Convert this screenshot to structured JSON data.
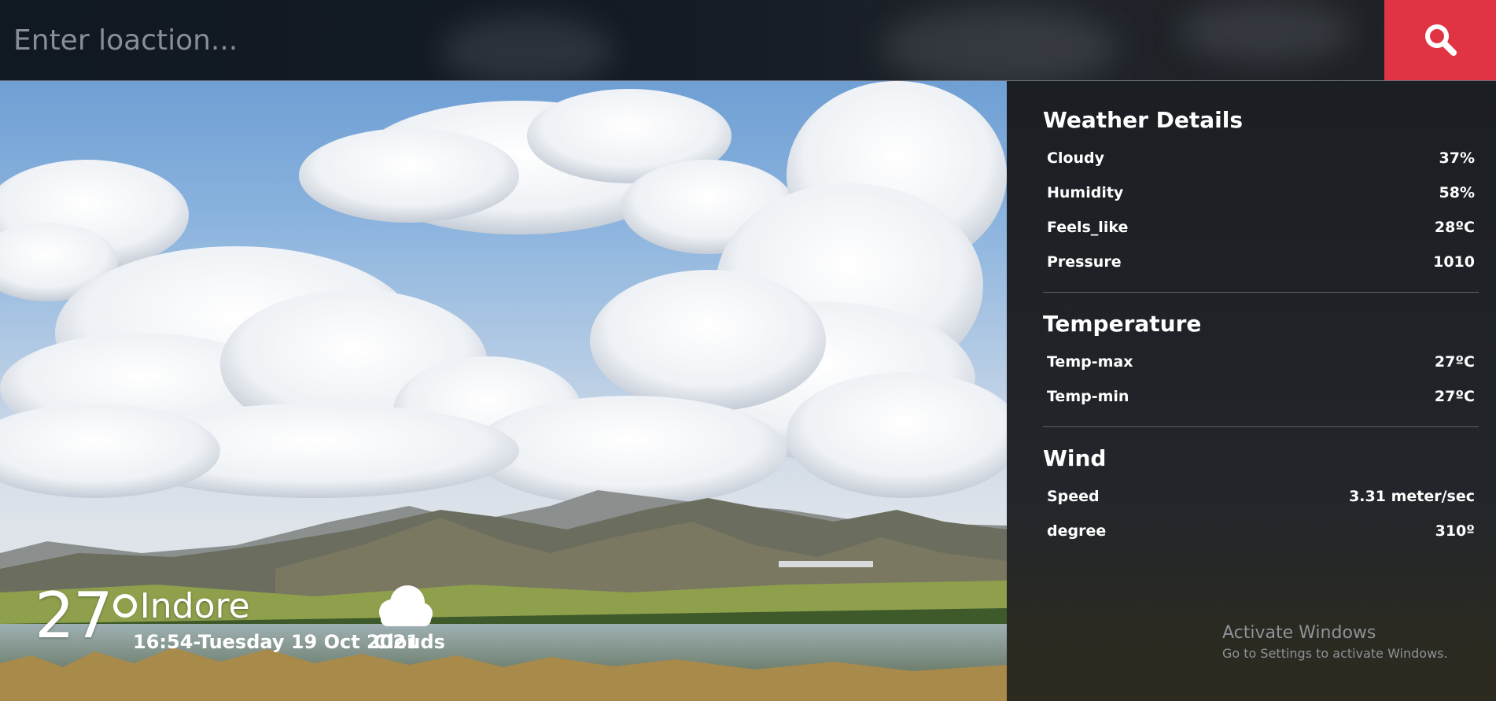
{
  "search": {
    "placeholder": "Enter loaction...",
    "button_icon": "search-icon",
    "button_color": "#e03444"
  },
  "current": {
    "temperature": "27",
    "degree_symbol": "o",
    "city": "Indore",
    "datetime": "16:54-Tuesday 19 Oct 2021",
    "condition": "Clouds",
    "condition_icon": "cloud-icon"
  },
  "details": {
    "weather": {
      "title": "Weather Details",
      "rows": [
        {
          "label": "Cloudy",
          "value": "37%"
        },
        {
          "label": "Humidity",
          "value": "58%"
        },
        {
          "label": "Feels_like",
          "value": "28ºC"
        },
        {
          "label": "Pressure",
          "value": "1010"
        }
      ]
    },
    "temperature": {
      "title": "Temperature",
      "rows": [
        {
          "label": "Temp-max",
          "value": "27ºC"
        },
        {
          "label": "Temp-min",
          "value": "27ºC"
        }
      ]
    },
    "wind": {
      "title": "Wind",
      "rows": [
        {
          "label": "Speed",
          "value": "3.31 meter/sec"
        },
        {
          "label": "degree",
          "value": "310º"
        }
      ]
    }
  },
  "watermark": {
    "title": "Activate Windows",
    "subtitle": "Go to Settings to activate Windows."
  }
}
